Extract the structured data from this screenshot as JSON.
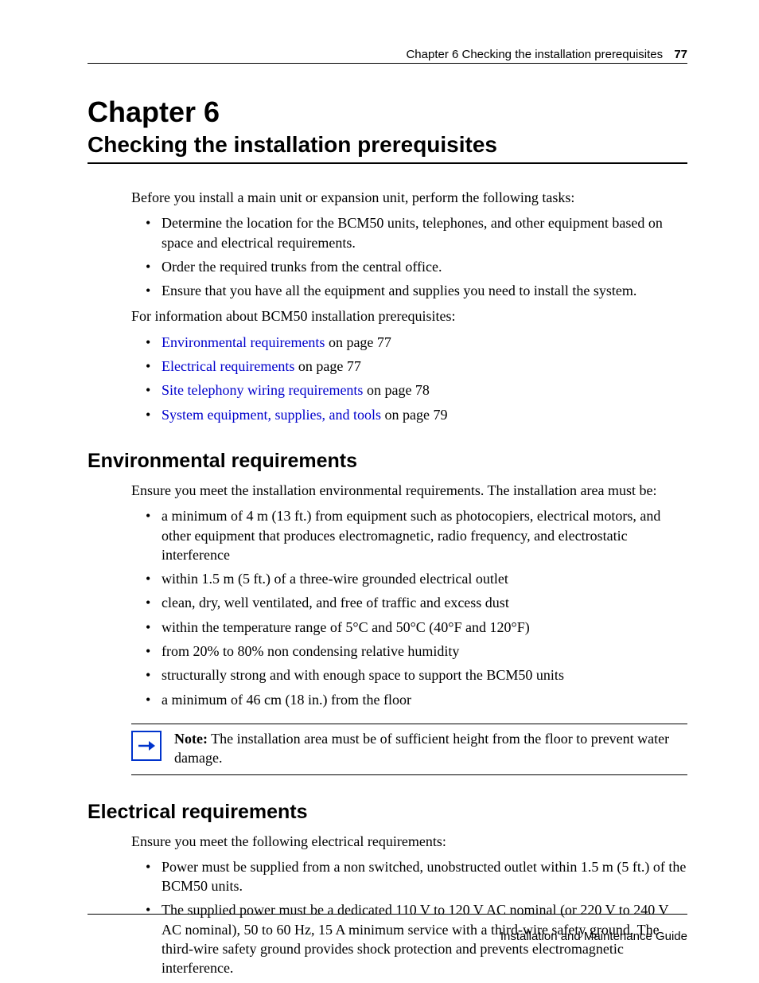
{
  "header": {
    "running_title": "Chapter 6  Checking the installation prerequisites",
    "page_number": "77"
  },
  "chapter": {
    "number": "Chapter 6",
    "title": "Checking the installation prerequisites"
  },
  "intro": {
    "lead": "Before you install a main unit or expansion unit, perform the following tasks:",
    "tasks": [
      "Determine the location for the BCM50 units, telephones, and other equipment based on space and electrical requirements.",
      "Order the required trunks from the central office.",
      "Ensure that you have all the equipment and supplies you need to install the system."
    ],
    "refs_lead": "For information about BCM50 installation prerequisites:",
    "refs": [
      {
        "link": "Environmental requirements",
        "suffix": " on page 77"
      },
      {
        "link": "Electrical requirements",
        "suffix": " on page 77"
      },
      {
        "link": "Site telephony wiring requirements",
        "suffix": " on page 78"
      },
      {
        "link": "System equipment, supplies, and tools",
        "suffix": " on page 79"
      }
    ]
  },
  "env": {
    "heading": "Environmental requirements",
    "lead": "Ensure you meet the installation environmental requirements. The installation area must be:",
    "items": [
      "a minimum of 4 m (13 ft.) from equipment such as photocopiers, electrical motors, and other equipment that produces electromagnetic, radio frequency, and electrostatic interference",
      "within 1.5 m (5 ft.) of a three-wire grounded electrical outlet",
      "clean, dry, well ventilated, and free of traffic and excess dust",
      "within the temperature range of 5°C and 50°C (40°F and 120°F)",
      "from 20% to 80% non condensing relative humidity",
      "structurally strong and with enough space to support the BCM50 units",
      "a minimum of 46 cm (18 in.) from the floor"
    ],
    "note_label": "Note:",
    "note_text": " The installation area must be of sufficient height from the floor to prevent water damage."
  },
  "elec": {
    "heading": "Electrical requirements",
    "lead": "Ensure you meet the following electrical requirements:",
    "items": [
      "Power must be supplied from a non switched, unobstructed outlet within 1.5 m (5 ft.) of the BCM50 units.",
      "The supplied power must be a dedicated 110 V to 120 V AC nominal (or 220 V to 240 V AC nominal), 50 to 60 Hz, 15 A minimum service with a third-wire safety ground. The third-wire safety ground provides shock protection and prevents electromagnetic interference."
    ]
  },
  "footer": {
    "text": "Installation and Maintenance Guide"
  }
}
